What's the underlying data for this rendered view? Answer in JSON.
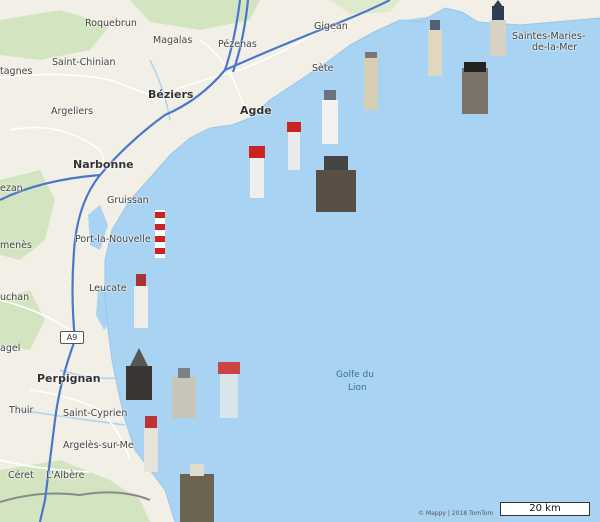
{
  "map": {
    "places": [
      {
        "id": "roquebrun",
        "label": "Roquebrun"
      },
      {
        "id": "magalas",
        "label": "Magalas"
      },
      {
        "id": "pezenas",
        "label": "Pézenas"
      },
      {
        "id": "gigean",
        "label": "Gigean"
      },
      {
        "id": "saintes-maries",
        "label": "Saintes-Maries-"
      },
      {
        "id": "saintes-maries-2",
        "label": "de-la-Mer"
      },
      {
        "id": "olargues",
        "label": "tagnes"
      },
      {
        "id": "saint-chinian",
        "label": "Saint-Chinian"
      },
      {
        "id": "sete",
        "label": "Sète"
      },
      {
        "id": "beziers",
        "label": "Béziers"
      },
      {
        "id": "argeliers",
        "label": "Argeliers"
      },
      {
        "id": "agde",
        "label": "Agde"
      },
      {
        "id": "narbonne",
        "label": "Narbonne"
      },
      {
        "id": "lezignan",
        "label": "ezan"
      },
      {
        "id": "gruissan",
        "label": "Gruissan"
      },
      {
        "id": "port-la-nouvelle",
        "label": "Port-la-Nouvelle"
      },
      {
        "id": "tuchan",
        "label": "menès"
      },
      {
        "id": "leucate",
        "label": "Leucate"
      },
      {
        "id": "duchan",
        "label": "uchan"
      },
      {
        "id": "ille",
        "label": "agel"
      },
      {
        "id": "perpignan",
        "label": "Perpignan"
      },
      {
        "id": "thuir",
        "label": "Thuir"
      },
      {
        "id": "saint-cyprien",
        "label": "Saint-Cyprien"
      },
      {
        "id": "argeles",
        "label": "Argelès-sur-Me"
      },
      {
        "id": "ceret",
        "label": "Céret"
      },
      {
        "id": "albere",
        "label": "L'Albère"
      }
    ],
    "sea_label": [
      "Golfe du",
      "Lion"
    ],
    "road_shield": "A9",
    "scale_label": "20 km",
    "copyright": "© Mappy | 2018 TomTom",
    "colors": {
      "sea": "#a9d3f2",
      "land": "#f2efe6",
      "forest": "#d3e5c0",
      "road": "#4a78c8"
    }
  }
}
